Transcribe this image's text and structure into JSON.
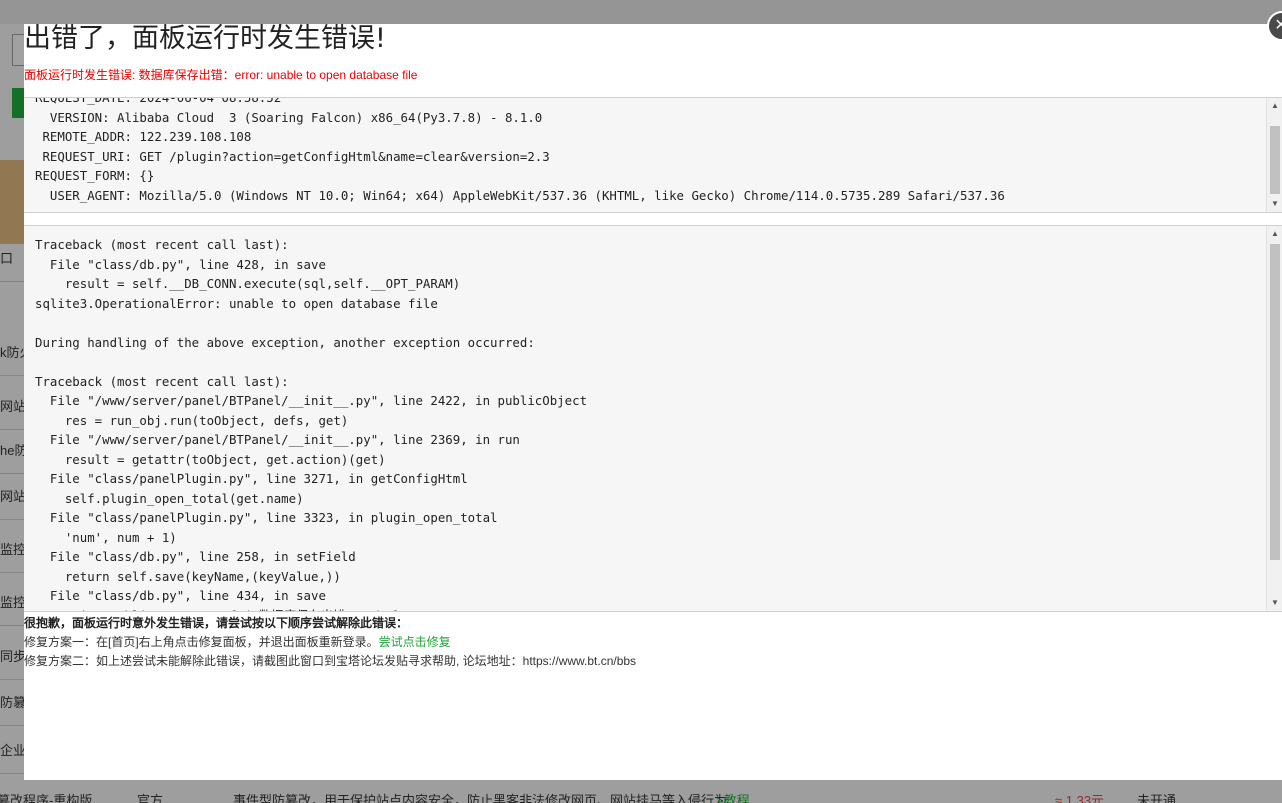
{
  "background": {
    "sidebar_fragments": [
      "口",
      "k防火",
      "网站",
      "he防",
      "网站",
      "监控",
      "监控",
      "同步",
      "防篡改",
      "企业"
    ],
    "bottom_row": {
      "name": "防篡改程序-重构版",
      "developer": "官方",
      "description": "事件型防篡改，用于保护站点内容安全，防止黑客非法修改网页、网站挂马等入侵行为",
      "tutorial_link": ">教程",
      "price": "≈ 1.33元",
      "status": "未开通"
    }
  },
  "dialog": {
    "title": "出错了，面板运行时发生错误!",
    "error_summary": "面板运行时发生错误: 数据库保存出错：error: unable to open database file",
    "request_info": "REQUEST_DATE: 2024-06-04 08:58:52\n  VERSION: Alibaba Cloud  3 (Soaring Falcon) x86_64(Py3.7.8) - 8.1.0\n REMOTE_ADDR: 122.239.108.108\n REQUEST_URI: GET /plugin?action=getConfigHtml&name=clear&version=2.3\nREQUEST_FORM: {}\n  USER_AGENT: Mozilla/5.0 (Windows NT 10.0; Win64; x64) AppleWebKit/537.36 (KHTML, like Gecko) Chrome/114.0.5735.289 Safari/537.36",
    "traceback": "Traceback (most recent call last):\n  File \"class/db.py\", line 428, in save\n    result = self.__DB_CONN.execute(sql,self.__OPT_PARAM)\nsqlite3.OperationalError: unable to open database file\n\nDuring handling of the above exception, another exception occurred:\n\nTraceback (most recent call last):\n  File \"/www/server/panel/BTPanel/__init__.py\", line 2422, in publicObject\n    res = run_obj.run(toObject, defs, get)\n  File \"/www/server/panel/BTPanel/__init__.py\", line 2369, in run\n    result = getattr(toObject, get.action)(get)\n  File \"class/panelPlugin.py\", line 3271, in getConfigHtml\n    self.plugin_open_total(get.name)\n  File \"class/panelPlugin.py\", line 3323, in plugin_open_total\n    'num', num + 1)\n  File \"class/db.py\", line 258, in setField\n    return self.save(keyName,(keyValue,))\n  File \"class/db.py\", line 434, in save\n    raise public.error_conf_(\"数据库保存出错\", e) from None",
    "fix": {
      "heading": "很抱歉，面板运行时意外发生错误，请尝试按以下顺序尝试解除此错误：",
      "plan1_text": "修复方案一：在[首页]右上角点击修复面板，并退出面板重新登录。",
      "plan1_link": "尝试点击修复",
      "plan2_text": "修复方案二：如上述尝试未能解除此错误，请截图此窗口到宝塔论坛发贴寻求帮助, 论坛地址：https://www.bt.cn/bbs"
    }
  },
  "icons": {
    "close": "×",
    "scroll_up": "▲",
    "scroll_down": "▼"
  }
}
